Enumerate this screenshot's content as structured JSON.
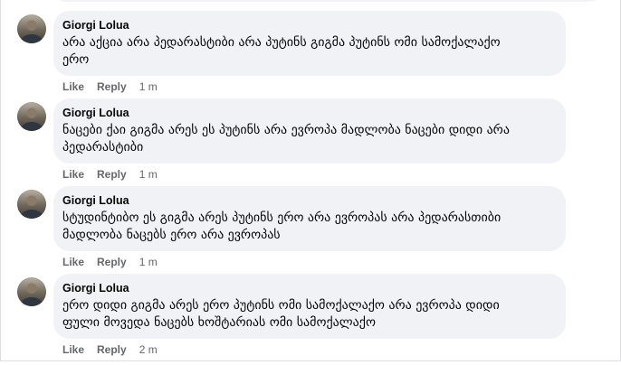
{
  "comments": [
    {
      "author": "Giorgi Lolua",
      "text": "არა აქცია არა პედარასტიბი არა პუტინს გიგმა პუტინს ომი სამოქალაქო\nერო",
      "like": "Like",
      "reply": "Reply",
      "time": "1 m"
    },
    {
      "author": "Giorgi Lolua",
      "text": "ნაცები ქაი გიგმა არეს ეს პუტინს არა ევროპა მადლობა ნაცები დიდი არა\nპედარასტიბი",
      "like": "Like",
      "reply": "Reply",
      "time": "1 m"
    },
    {
      "author": "Giorgi Lolua",
      "text": "სტუდინტიბო ეს გიგმა არეს პუტინს ერო არა ევროპას არა პედარასთიბი\nმადლობა ნაცებს ერო არა ევროპას",
      "like": "Like",
      "reply": "Reply",
      "time": "1 m"
    },
    {
      "author": "Giorgi Lolua",
      "text": "ერო დიდი გიგმა არეს ერო პუტინს ომი სამოქალაქო არა ევროპა დიდი\nფული მოვედა ნაცებს ხოშტარიას ომი სამოქალაქო",
      "like": "Like",
      "reply": "Reply",
      "time": "2 m"
    }
  ]
}
